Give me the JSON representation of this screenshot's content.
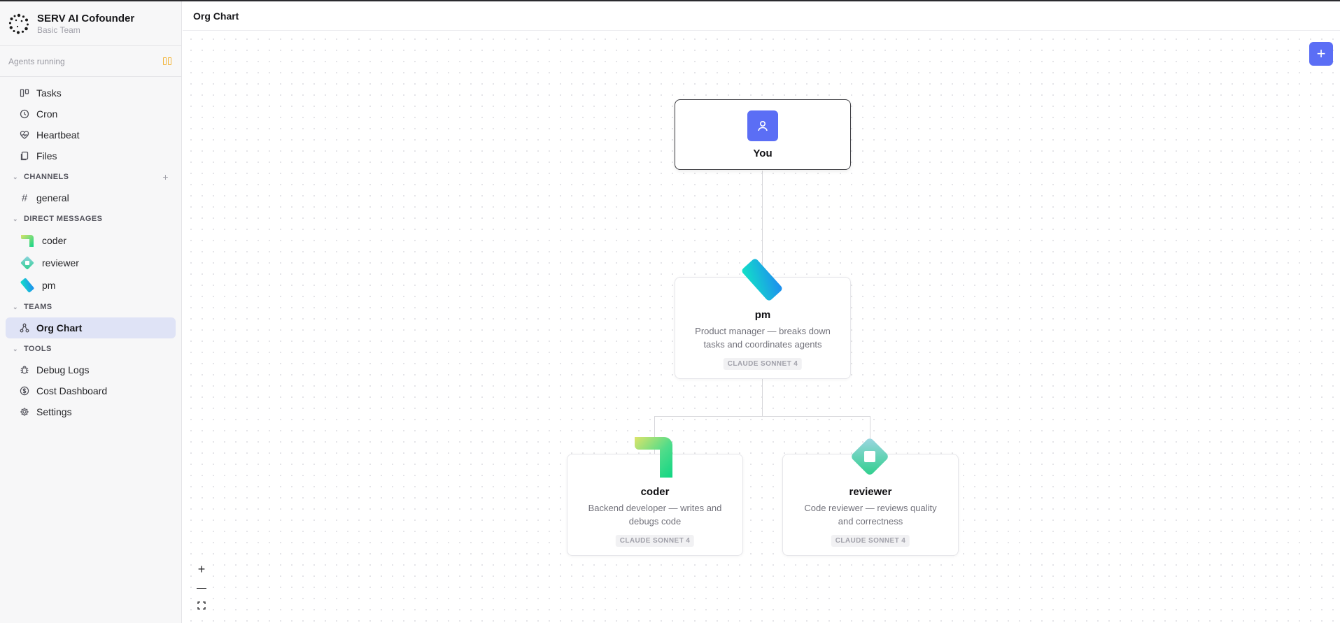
{
  "app": {
    "title": "SERV AI Cofounder",
    "subtitle": "Basic Team"
  },
  "status": {
    "agents_label": "Agents running",
    "pause_icon": "pause-icon",
    "accent": "#f2b63c"
  },
  "nav": {
    "items": [
      {
        "label": "Tasks",
        "icon": "tasks-icon"
      },
      {
        "label": "Cron",
        "icon": "clock-icon"
      },
      {
        "label": "Heartbeat",
        "icon": "heartbeat-icon"
      },
      {
        "label": "Files",
        "icon": "files-icon"
      }
    ]
  },
  "channels": {
    "header": "CHANNELS",
    "items": [
      {
        "label": "general"
      }
    ]
  },
  "direct_messages": {
    "header": "DIRECT MESSAGES",
    "items": [
      {
        "label": "coder"
      },
      {
        "label": "reviewer"
      },
      {
        "label": "pm"
      }
    ]
  },
  "teams": {
    "header": "TEAMS",
    "items": [
      {
        "label": "Org Chart",
        "active": true
      }
    ]
  },
  "tools": {
    "header": "TOOLS",
    "items": [
      {
        "label": "Debug Logs"
      },
      {
        "label": "Cost Dashboard"
      },
      {
        "label": "Settings"
      }
    ]
  },
  "page": {
    "title": "Org Chart"
  },
  "org": {
    "you": {
      "name": "You"
    },
    "pm": {
      "name": "pm",
      "description": "Product manager — breaks down tasks and coordinates agents",
      "model": "CLAUDE SONNET 4"
    },
    "coder": {
      "name": "coder",
      "description": "Backend developer — writes and debugs code",
      "model": "CLAUDE SONNET 4"
    },
    "reviewer": {
      "name": "reviewer",
      "description": "Code reviewer — reviews quality and correctness",
      "model": "CLAUDE SONNET 4"
    }
  },
  "controls": {
    "add": "+",
    "zoom_in": "+",
    "zoom_out": "—"
  },
  "colors": {
    "primary": "#5b6ef5",
    "active_nav": "#dfe3f6"
  }
}
